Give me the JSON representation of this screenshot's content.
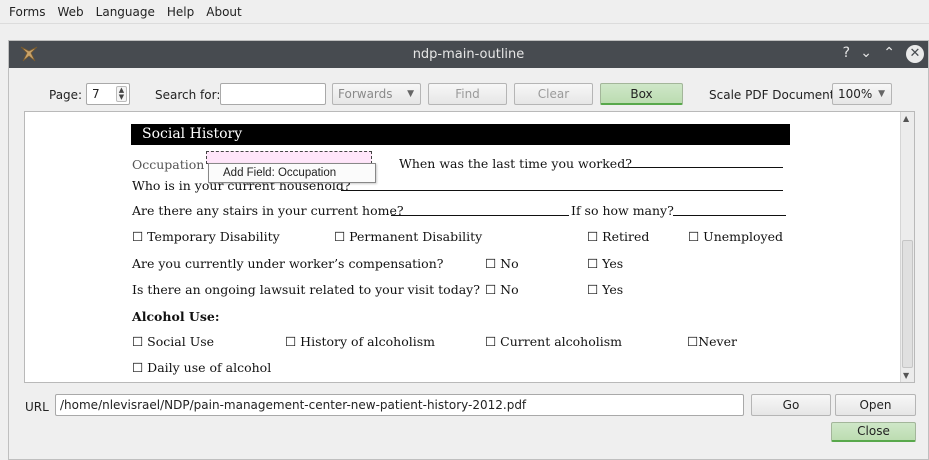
{
  "menubar": {
    "items": [
      "Forms",
      "Web",
      "Language",
      "Help",
      "About"
    ]
  },
  "window": {
    "title": "ndp-main-outline",
    "controls": {
      "help": "?",
      "minimize": "⌄",
      "maximize": "⌃",
      "close": "✕"
    }
  },
  "toolbar": {
    "page_label": "Page:",
    "page_value": "7",
    "search_label": "Search for:",
    "search_value": "",
    "direction": "Forwards",
    "find_label": "Find",
    "clear_label": "Clear",
    "box_label": "Box",
    "scale_label": "Scale PDF Document:",
    "scale_value": "100%"
  },
  "document": {
    "section_title": "Social History",
    "occupation_label": "Occupation",
    "tooltip": "Add Field: Occupation",
    "last_worked": "When was the last time you worked?",
    "household": "Who is in your current household?",
    "stairs": "Are there any stairs in your current home?",
    "how_many": "If so how many?",
    "opt_temp": "☐ Temporary Disability",
    "opt_perm": "☐ Permanent Disability",
    "opt_retired": "☐ Retired",
    "opt_unemployed": "☐ Unemployed",
    "workers_comp": "Are you currently under worker’s compensation?",
    "lawsuit": "Is there an ongoing lawsuit related to your visit today?",
    "no": "☐ No",
    "yes": "☐ Yes",
    "alcohol_heading": "Alcohol Use:",
    "alc_social": "☐ Social Use",
    "alc_history": "☐ History of alcoholism",
    "alc_current": "☐ Current alcoholism",
    "alc_never": "☐Never",
    "alc_daily": "☐ Daily use of alcohol"
  },
  "url_bar": {
    "label": "URL",
    "value": "/home/nlevisrael/NDP/pain-management-center-new-patient-history-2012.pdf",
    "go_label": "Go",
    "open_label": "Open",
    "close_label": "Close"
  }
}
